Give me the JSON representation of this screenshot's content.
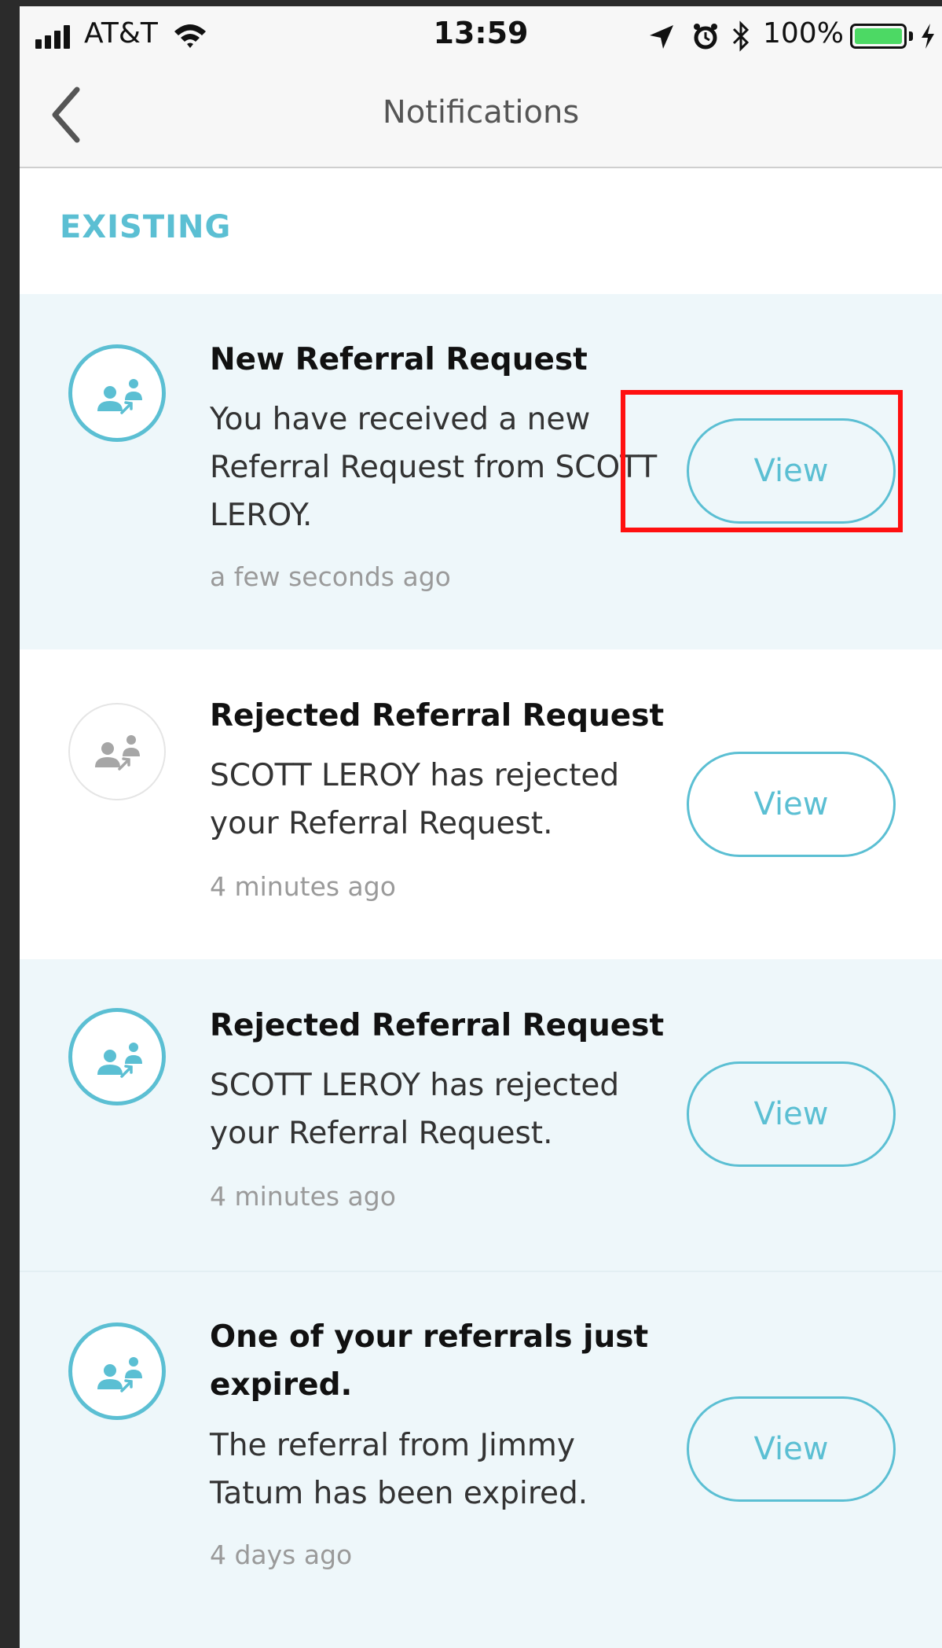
{
  "status_bar": {
    "carrier": "AT&T",
    "time": "13:59",
    "battery": "100%",
    "battery_level": 1.0,
    "icons": [
      "signal-icon",
      "wifi-icon",
      "location-arrow-icon",
      "alarm-icon",
      "bluetooth-icon",
      "battery-icon",
      "charging-bolt-icon"
    ]
  },
  "navbar": {
    "title": "Notifications",
    "back_icon": "chevron-left-icon"
  },
  "section": {
    "title": "EXISTING"
  },
  "notifications": [
    {
      "title": "New Referral Request",
      "body": "You have received a new Referral Request from SCOTT LEROY.",
      "time": "a few seconds ago",
      "button": "View",
      "icon": "referral-icon",
      "state": "active"
    },
    {
      "title": "Rejected Referral Request",
      "body": "SCOTT LEROY has rejected your Referral Request.",
      "time": "4 minutes ago",
      "button": "View",
      "icon": "referral-icon",
      "state": "inactive"
    },
    {
      "title": "Rejected Referral Request",
      "body": "SCOTT LEROY has rejected your Referral Request.",
      "time": "4 minutes ago",
      "button": "View",
      "icon": "referral-icon",
      "state": "active"
    },
    {
      "title": "One of your referrals just expired.",
      "body": "The referral from Jimmy Tatum has been expired.",
      "time": "4 days ago",
      "button": "View",
      "icon": "referral-icon",
      "state": "active"
    }
  ],
  "colors": {
    "accent": "#5bbfd3",
    "highlight": "#ff1010",
    "tint_background": "#eef7fa",
    "icon_inactive": "#a6a6a6"
  }
}
